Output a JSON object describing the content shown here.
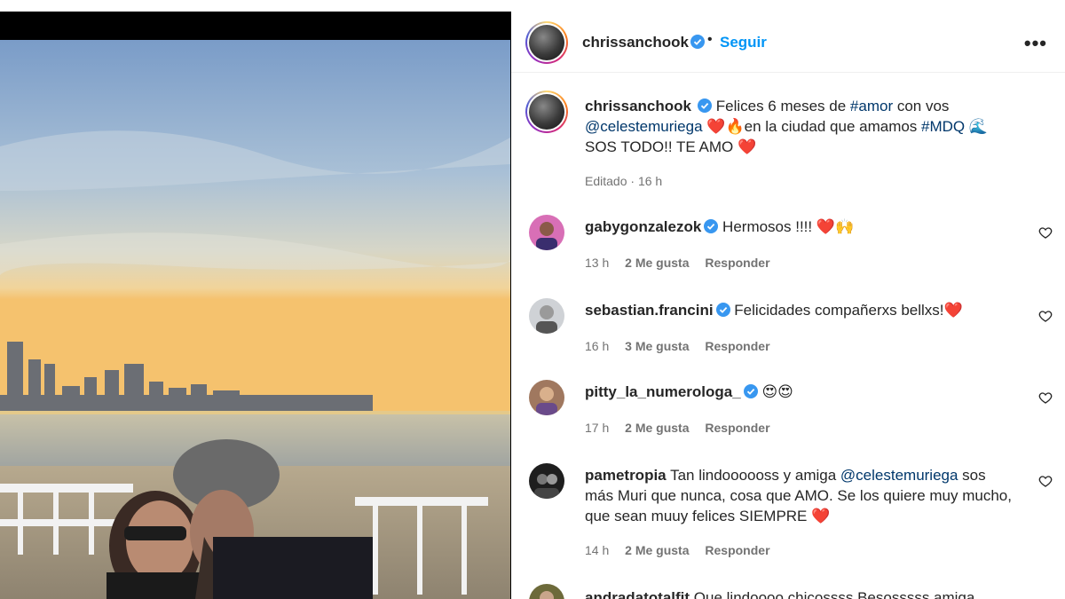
{
  "post": {
    "author": "chrissanchook",
    "follow_label": "Seguir",
    "separator": "•",
    "more_label": "•••"
  },
  "caption": {
    "author": "chrissanchook",
    "line1_text": "Felices 6 meses de ",
    "hashtag_amor": "#amor",
    "line1_end": " con vos",
    "mention": "@celestemuriega",
    "line2_emoji1": "❤️",
    "line2_emoji2": "🔥",
    "line2_text": "en la ciudad que amamos ",
    "hashtag_mdq": "#MDQ",
    "line2_emoji3": "🌊",
    "line3_text": "SOS TODO!! TE AMO ",
    "line3_emoji": "❤️",
    "meta_edited": "Editado",
    "meta_sep": "·",
    "meta_time": "16 h"
  },
  "comments": [
    {
      "user": "gabygonzalezok",
      "verified": true,
      "text": "Hermosos !!!! ",
      "emoji": "❤️🙌",
      "time": "13 h",
      "likes": "2 Me gusta",
      "reply": "Responder"
    },
    {
      "user": "sebastian.francini",
      "verified": true,
      "text": "Felicidades compañerxs bellxs!",
      "emoji": "❤️",
      "time": "16 h",
      "likes": "3 Me gusta",
      "reply": "Responder"
    },
    {
      "user": "pitty_la_numerologa_",
      "verified": true,
      "text": "",
      "emoji": "😍😍",
      "time": "17 h",
      "likes": "2 Me gusta",
      "reply": "Responder"
    },
    {
      "user": "pametropia",
      "verified": false,
      "text_a": "Tan lindoooooss y amiga ",
      "mention": "@celestemuriega",
      "text_b": " sos",
      "line2": "más Muri que nunca, cosa que AMO. Se los quiere muy mucho,",
      "line3": "que sean muuy felices SIEMPRE ",
      "emoji": "❤️",
      "time": "14 h",
      "likes": "2 Me gusta",
      "reply": "Responder"
    },
    {
      "user": "andradatotalfit",
      "verified": false,
      "text": "Que lindoooo chicossss Besosssss amiga"
    }
  ],
  "colors": {
    "accent": "#0095f6",
    "verified": "#3897f0",
    "link": "#00376b",
    "secondary": "#737373"
  }
}
